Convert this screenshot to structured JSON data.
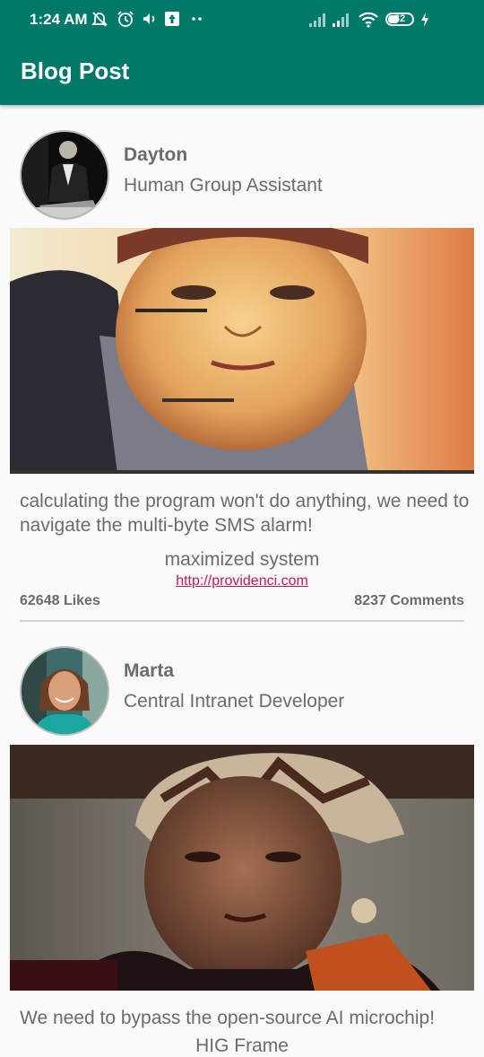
{
  "status_bar": {
    "time": "1:24 AM",
    "battery": "32",
    "icons": [
      "mute-icon",
      "alarm-icon",
      "volume-icon",
      "upload-icon",
      "more-dots-icon",
      "signal-icon",
      "signal-icon",
      "wifi-icon",
      "battery-icon",
      "charging-icon"
    ]
  },
  "app_bar": {
    "title": "Blog Post"
  },
  "posts": [
    {
      "author": "Dayton",
      "role": "Human Group Assistant",
      "text": "calculating the program won't do anything, we need to navigate the multi-byte SMS alarm!",
      "text_line1": "calculating the program won't do anything, we need to",
      "text_line2": "navigate the multi-byte SMS alarm!",
      "tagline": "maximized system",
      "link": "http://providenci.com",
      "likes": "62648 Likes",
      "comments": "8237 Comments"
    },
    {
      "author": "Marta",
      "role": "Central Intranet Developer",
      "text_line1": "We need to bypass the open-source AI microchip!",
      "tagline": "HIG Frame"
    }
  ],
  "colors": {
    "primary": "#00796b",
    "link": "#c2185b",
    "text": "#6b6b6b",
    "background": "#fafafa"
  }
}
